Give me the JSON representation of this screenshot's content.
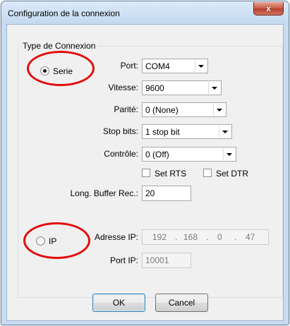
{
  "window": {
    "title": "Configuration de la connexion",
    "close_glyph": "x"
  },
  "group": {
    "label": "Type de Connexion"
  },
  "serie": {
    "radio_label": "Serie",
    "checked": true,
    "port": {
      "label": "Port:",
      "value": "COM4"
    },
    "vitesse": {
      "label": "Vitesse:",
      "value": "9600"
    },
    "parite": {
      "label": "Parité:",
      "value": "0 (None)"
    },
    "stop_bits": {
      "label": "Stop bits:",
      "value": "1 stop bit"
    },
    "controle": {
      "label": "Contrôle:",
      "value": "0 (Off)"
    },
    "set_rts": {
      "label": "Set RTS",
      "checked": false
    },
    "set_dtr": {
      "label": "Set DTR",
      "checked": false
    },
    "buffer": {
      "label": "Long. Buffer Rec.:",
      "value": "20"
    }
  },
  "ip": {
    "radio_label": "IP",
    "checked": false,
    "address": {
      "label": "Adresse IP:",
      "octets": [
        "192",
        "168",
        "0",
        "47"
      ]
    },
    "port": {
      "label": "Port IP:",
      "value": "10001"
    }
  },
  "buttons": {
    "ok": "OK",
    "cancel": "Cancel"
  },
  "annotation_color": "#e30c0c"
}
